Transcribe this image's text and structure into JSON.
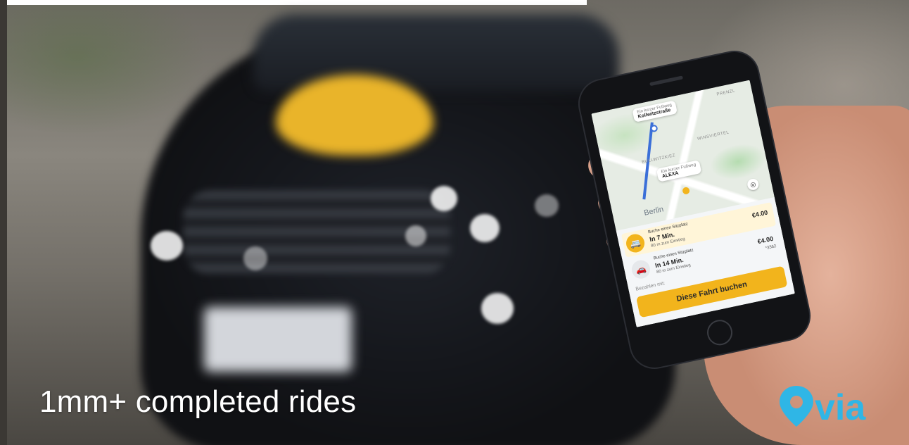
{
  "caption": "1mm+ completed rides",
  "logo": {
    "text": "via",
    "color": "#2fb6e6"
  },
  "phone_app": {
    "map": {
      "callout_top_small": "Ein kurzer Fußweg",
      "callout_top_big": "Kollwitzstraße",
      "callout_mid_small": "Ein kurzer Fußweg",
      "callout_mid_big": "ALEXA",
      "district_labels": [
        "PRENZL",
        "WINSVIERTEL",
        "BULLWITZKIEZ"
      ],
      "city": "Berlin",
      "locate_icon": "target-icon"
    },
    "rides": [
      {
        "label": "Buche einen Sitzplatz",
        "eta": "In 7 Min.",
        "walk": "80 m zum Einstieg",
        "price": "€4.00",
        "icon": "shuttle-icon"
      },
      {
        "label": "Buche einen Sitzplatz",
        "eta": "In 14 Min.",
        "walk": "80 m zum Einstieg",
        "price": "€4.00",
        "card": "*3362",
        "icon": "car-icon"
      }
    ],
    "pay_label": "Bezahlen mit:",
    "book_button": "Diese Fahrt buchen",
    "accent_color": "#f2b41c"
  }
}
